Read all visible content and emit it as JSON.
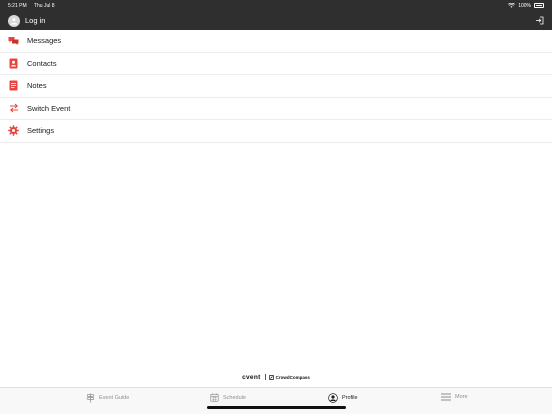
{
  "status_bar": {
    "time": "5:21 PM",
    "date": "Thu Jul 8",
    "battery": "100%"
  },
  "header": {
    "title": "Log in"
  },
  "menu": {
    "items": [
      {
        "label": "Messages",
        "icon": "messages-icon"
      },
      {
        "label": "Contacts",
        "icon": "contacts-icon"
      },
      {
        "label": "Notes",
        "icon": "notes-icon"
      },
      {
        "label": "Switch Event",
        "icon": "switch-event-icon"
      },
      {
        "label": "Settings",
        "icon": "settings-icon"
      }
    ]
  },
  "brand": {
    "primary": "cvent",
    "secondary": "CrowdCompass"
  },
  "tabs": [
    {
      "label": "Event Guide",
      "icon": "signpost-icon",
      "active": false
    },
    {
      "label": "Schedule",
      "icon": "calendar-icon",
      "active": false
    },
    {
      "label": "Profile",
      "icon": "profile-icon",
      "active": true
    },
    {
      "label": "More",
      "icon": "hamburger-icon",
      "active": false
    }
  ],
  "colors": {
    "accent": "#e8453c",
    "header": "#2f2f2f",
    "tab_inactive": "#8e8e8e"
  }
}
